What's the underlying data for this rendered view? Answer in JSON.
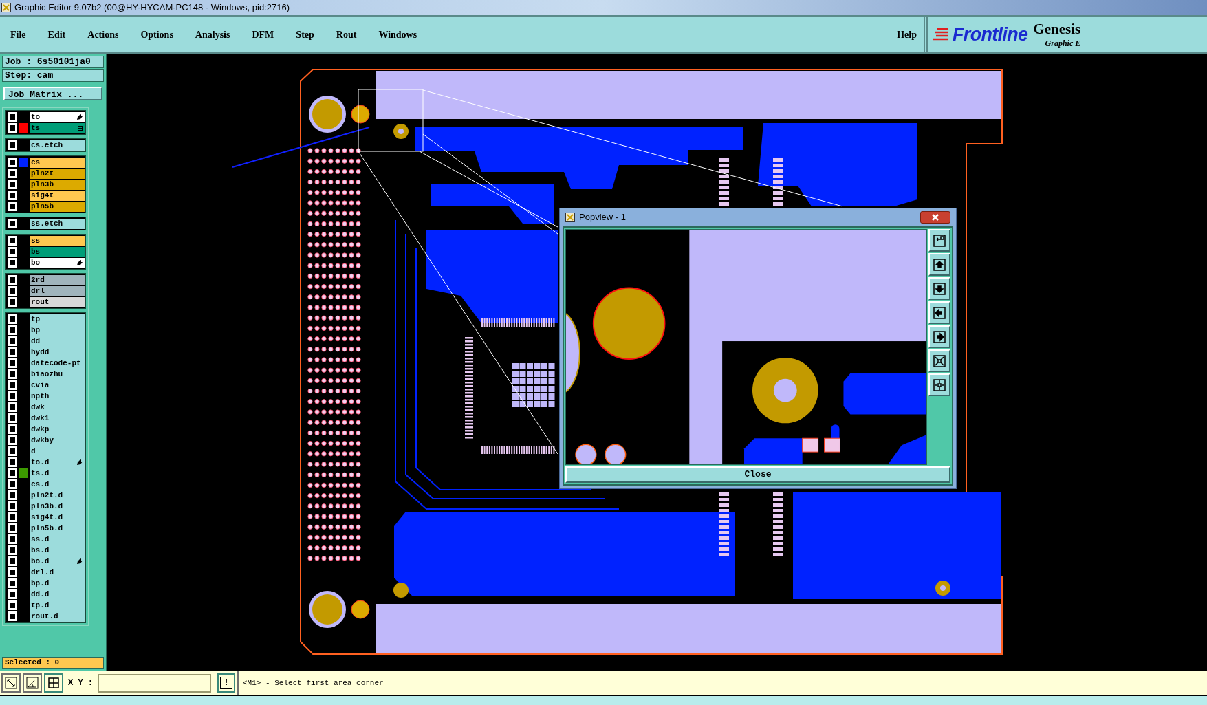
{
  "window": {
    "title": "Graphic Editor 9.07b2 (00@HY-HYCAM-PC148 - Windows, pid:2716)"
  },
  "menu": [
    {
      "label": "File"
    },
    {
      "label": "Edit"
    },
    {
      "label": "Actions"
    },
    {
      "label": "Options"
    },
    {
      "label": "Analysis"
    },
    {
      "label": "DFM"
    },
    {
      "label": "Step"
    },
    {
      "label": "Rout"
    },
    {
      "label": "Windows"
    }
  ],
  "help": "Help",
  "logo": {
    "brand": "Frontline",
    "product": "Genesis",
    "subtitle": "Graphic E"
  },
  "job": "Job : 6s50101ja0",
  "step": "Step: cam",
  "job_matrix_button": "Job Matrix ...",
  "layer_groups": [
    [
      {
        "name": "to",
        "kind": "silk",
        "checked": false,
        "affected": true,
        "work_layer": false
      },
      {
        "name": "ts",
        "kind": "mask",
        "checked": false,
        "color": "#ff0000",
        "affected": false,
        "work_layer": true
      }
    ],
    [
      {
        "name": "cs.etch",
        "kind": "misc",
        "checked": false,
        "affected": false,
        "work_layer": false
      }
    ],
    [
      {
        "name": "cs",
        "kind": "signal",
        "checked": false,
        "color": "#0022ff",
        "affected": false,
        "work_layer": false
      },
      {
        "name": "pln2t",
        "kind": "plane",
        "checked": false,
        "affected": false,
        "work_layer": false
      },
      {
        "name": "pln3b",
        "kind": "plane",
        "checked": false,
        "affected": false,
        "work_layer": false
      },
      {
        "name": "sig4t",
        "kind": "signal",
        "checked": false,
        "affected": false,
        "work_layer": false
      },
      {
        "name": "pln5b",
        "kind": "plane",
        "checked": false,
        "affected": false,
        "work_layer": false
      }
    ],
    [
      {
        "name": "ss.etch",
        "kind": "misc",
        "checked": false,
        "affected": false,
        "work_layer": false
      }
    ],
    [
      {
        "name": "ss",
        "kind": "signal",
        "checked": false,
        "affected": false,
        "work_layer": false
      },
      {
        "name": "bs",
        "kind": "mask",
        "checked": false,
        "affected": false,
        "work_layer": false
      },
      {
        "name": "bo",
        "kind": "silk",
        "checked": false,
        "affected": true,
        "work_layer": false
      }
    ],
    [
      {
        "name": "2rd",
        "kind": "drill",
        "checked": false,
        "affected": false,
        "work_layer": false
      },
      {
        "name": "drl",
        "kind": "drill",
        "checked": false,
        "affected": false,
        "work_layer": false
      },
      {
        "name": "rout",
        "kind": "rout",
        "checked": false,
        "affected": false,
        "work_layer": false
      }
    ],
    [
      {
        "name": "tp",
        "kind": "misc",
        "checked": false,
        "affected": false,
        "work_layer": false
      },
      {
        "name": "bp",
        "kind": "misc",
        "checked": false,
        "affected": false,
        "work_layer": false
      },
      {
        "name": "dd",
        "kind": "misc",
        "checked": false,
        "affected": false,
        "work_layer": false
      },
      {
        "name": "hydd",
        "kind": "misc",
        "checked": false,
        "affected": false,
        "work_layer": false
      },
      {
        "name": "datecode-pt",
        "kind": "misc",
        "checked": false,
        "affected": false,
        "work_layer": false
      },
      {
        "name": "biaozhu",
        "kind": "misc",
        "checked": false,
        "affected": false,
        "work_layer": false
      },
      {
        "name": "cvia",
        "kind": "misc",
        "checked": false,
        "affected": false,
        "work_layer": false
      },
      {
        "name": "npth",
        "kind": "misc",
        "checked": false,
        "affected": false,
        "work_layer": false
      },
      {
        "name": "dwk",
        "kind": "misc",
        "checked": false,
        "affected": false,
        "work_layer": false
      },
      {
        "name": "dwk1",
        "kind": "misc",
        "checked": false,
        "affected": false,
        "work_layer": false
      },
      {
        "name": "dwkp",
        "kind": "misc",
        "checked": false,
        "affected": false,
        "work_layer": false
      },
      {
        "name": "dwkby",
        "kind": "misc",
        "checked": false,
        "affected": false,
        "work_layer": false
      },
      {
        "name": "d",
        "kind": "misc",
        "checked": false,
        "affected": false,
        "work_layer": false
      },
      {
        "name": "to.d",
        "kind": "misc",
        "checked": false,
        "affected": true,
        "work_layer": false
      },
      {
        "name": "ts.d",
        "kind": "misc",
        "checked": false,
        "color": "#3c9a00",
        "affected": false,
        "work_layer": false
      },
      {
        "name": "cs.d",
        "kind": "misc",
        "checked": false,
        "affected": false,
        "work_layer": false
      },
      {
        "name": "pln2t.d",
        "kind": "misc",
        "checked": false,
        "affected": false,
        "work_layer": false
      },
      {
        "name": "pln3b.d",
        "kind": "misc",
        "checked": false,
        "affected": false,
        "work_layer": false
      },
      {
        "name": "sig4t.d",
        "kind": "misc",
        "checked": false,
        "affected": false,
        "work_layer": false
      },
      {
        "name": "pln5b.d",
        "kind": "misc",
        "checked": false,
        "affected": false,
        "work_layer": false
      },
      {
        "name": "ss.d",
        "kind": "misc",
        "checked": false,
        "affected": false,
        "work_layer": false
      },
      {
        "name": "bs.d",
        "kind": "misc",
        "checked": false,
        "affected": false,
        "work_layer": false
      },
      {
        "name": "bo.d",
        "kind": "misc",
        "checked": false,
        "affected": true,
        "work_layer": false
      },
      {
        "name": "drl.d",
        "kind": "misc",
        "checked": false,
        "affected": false,
        "work_layer": false
      },
      {
        "name": "bp.d",
        "kind": "misc",
        "checked": false,
        "affected": false,
        "work_layer": false
      },
      {
        "name": "dd.d",
        "kind": "misc",
        "checked": false,
        "affected": false,
        "work_layer": false
      },
      {
        "name": "tp.d",
        "kind": "misc",
        "checked": false,
        "affected": false,
        "work_layer": false
      },
      {
        "name": "rout.d",
        "kind": "misc",
        "checked": false,
        "affected": false,
        "work_layer": false
      }
    ]
  ],
  "selected": "Selected : 0",
  "popview": {
    "title": "Popview - 1",
    "close_button": "Close"
  },
  "command_bar": {
    "xy_label": "X Y :",
    "bang_button": "!",
    "prompt": "<M1> - Select first area corner"
  }
}
